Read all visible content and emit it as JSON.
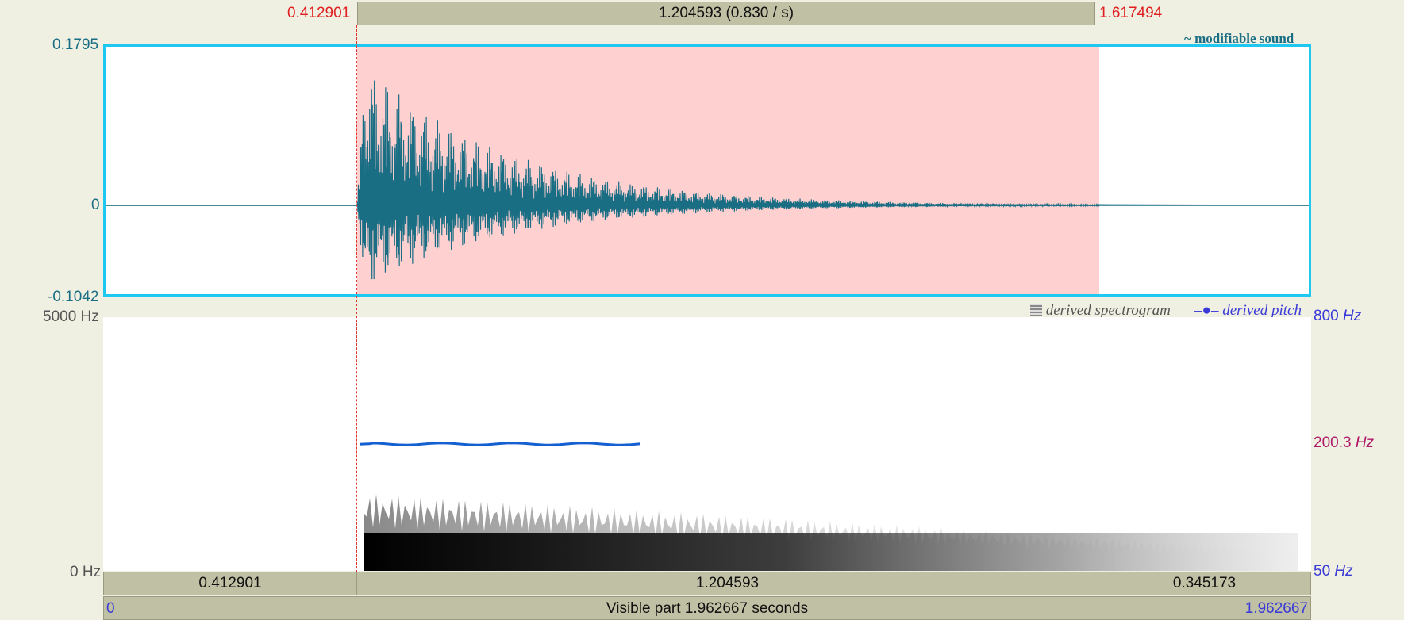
{
  "selection": {
    "start": "0.412901",
    "end": "1.617494",
    "duration_label": "1.204593 (0.830 / s)",
    "start_fraction": 0.2104,
    "end_fraction": 0.8241
  },
  "waveform": {
    "y_max": "0.1795",
    "y_zero": "0",
    "y_min": "-0.1042",
    "label": "~ modifiable sound",
    "color": "#1a6e84",
    "selection_color": "#ffd0d0",
    "border_color": "#1ec8f0"
  },
  "spectrogram": {
    "freq_max": "5000 Hz",
    "freq_min": "0 Hz",
    "legend_spectrogram": "derived spectrogram",
    "legend_pitch": "derived pitch",
    "pitch_max": "800",
    "pitch_mid": "200.3",
    "pitch_min": "50",
    "pitch_unit": "Hz",
    "pitch_color": "#1560d0"
  },
  "segments": {
    "left": "0.412901",
    "middle": "1.204593",
    "right": "0.345173"
  },
  "visible": {
    "start": "0",
    "label": "Visible part 1.962667 seconds",
    "end": "1.962667"
  }
}
